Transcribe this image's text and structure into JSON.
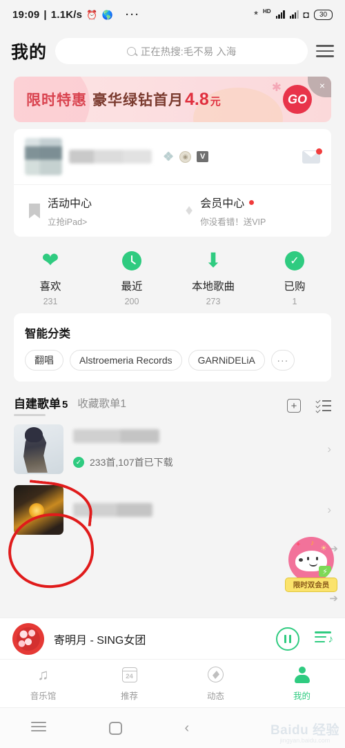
{
  "statusbar": {
    "time": "19:09",
    "separator": "|",
    "network_speed": "1.1K/s",
    "alarm_icon": "alarm-clock-icon",
    "globe_icon": "globe-icon",
    "overflow": "···",
    "hd_label": "HD",
    "bluetooth_icon": "bluetooth-icon",
    "wifi_icon": "wifi-icon",
    "battery": "30"
  },
  "header": {
    "title": "我的",
    "search_placeholder": "正在热搜:毛不易 入海",
    "menu_icon": "hamburger-menu-icon"
  },
  "banner": {
    "text_1": "限时特惠",
    "text_2": "豪华绿钻首月",
    "price": "4.8",
    "unit": "元",
    "cta": "GO",
    "close_icon": "×"
  },
  "profile": {
    "name_redacted": "",
    "badges": [
      "diamond-badge",
      "medal-badge",
      "v-badge"
    ],
    "diamond_glyph": "❖",
    "medal_glyph": "§",
    "v_glyph": "V",
    "mail_icon": "mail-icon",
    "mail_has_unread": true
  },
  "entries": [
    {
      "icon": "bookmark-icon",
      "title": "活动中心",
      "subtitle": "立抢iPad>",
      "has_dot": false
    },
    {
      "icon": "diamond-icon",
      "title": "会员中心",
      "subtitle": "你没看错！送VIP",
      "has_dot": true
    }
  ],
  "stats": [
    {
      "icon": "heart-icon",
      "label": "喜欢",
      "count": "231"
    },
    {
      "icon": "clock-icon",
      "label": "最近",
      "count": "200"
    },
    {
      "icon": "download-icon",
      "label": "本地歌曲",
      "count": "273"
    },
    {
      "icon": "check-circle-icon",
      "label": "已购",
      "count": "1"
    }
  ],
  "smart_classify": {
    "title": "智能分类",
    "chips": [
      "翻唱",
      "Alstroemeria Records",
      "GARNiDELiA"
    ],
    "more_chip": "···"
  },
  "playlists": {
    "tab_active_label": "自建歌单",
    "tab_active_count": "5",
    "tab_inactive_label": "收藏歌单",
    "tab_inactive_count": "1",
    "add_icon": "add-playlist-icon",
    "manage_icon": "multi-select-icon",
    "rows": [
      {
        "thumb": "anime-character-artwork",
        "name_redacted": "",
        "subtitle": "233首,107首已下载",
        "downloaded_badge": "download-complete-icon"
      },
      {
        "thumb": "dark-orange-artwork",
        "name_redacted": "",
        "subtitle": "",
        "downloaded_badge": ""
      }
    ]
  },
  "mascot": {
    "label": "限时双会员",
    "character": "pink-dog-mascot"
  },
  "miniplayer": {
    "now_playing": "寄明月 - SING女团",
    "pause_icon": "pause-button-icon",
    "queue_icon": "play-queue-icon"
  },
  "bottomnav": [
    {
      "icon": "music-note-icon",
      "label": "音乐馆",
      "active": false
    },
    {
      "icon": "calendar-icon",
      "label": "推荐",
      "active": false,
      "badge": "24"
    },
    {
      "icon": "compass-icon",
      "label": "动态",
      "active": false
    },
    {
      "icon": "person-icon",
      "label": "我的",
      "active": true
    }
  ],
  "androidnav": {
    "menu_icon": "android-menu-icon",
    "home_icon": "android-home-icon",
    "back_icon": "‹"
  },
  "watermark": {
    "line1": "Baidu 经验",
    "line2": "jingyan.baidu.com"
  },
  "colors": {
    "accent_green": "#2fcb80",
    "banner_red": "#e0303f",
    "alert_red": "#f13d3d",
    "annotation_red": "#e01b1b",
    "mascot_pink": "#f2729a"
  }
}
